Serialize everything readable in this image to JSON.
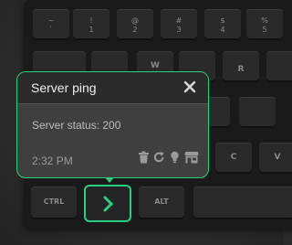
{
  "popup": {
    "title": "Server ping",
    "body": "Server status: 200",
    "time": "2:32 PM",
    "icons": [
      "trash-icon",
      "refresh-icon",
      "lightbulb-icon",
      "store-icon"
    ]
  },
  "keyboard": {
    "number_row": [
      {
        "top": "~",
        "bottom": "`"
      },
      {
        "top": "!",
        "bottom": "1"
      },
      {
        "top": "@",
        "bottom": "2"
      },
      {
        "top": "#",
        "bottom": "3"
      },
      {
        "top": "$",
        "bottom": "4"
      },
      {
        "top": "%",
        "bottom": "5"
      }
    ],
    "letters": [
      "W",
      "R",
      "C",
      "V",
      "B"
    ],
    "bottom_row": {
      "left": "CTRL",
      "right": "ALT"
    }
  },
  "colors": {
    "accent": "#27d17f"
  }
}
